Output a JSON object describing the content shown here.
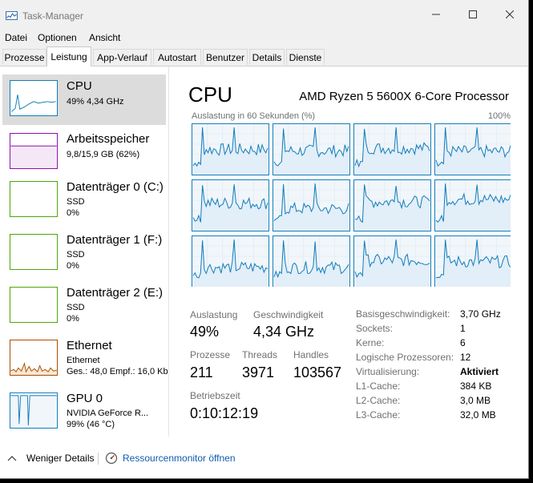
{
  "window": {
    "title": "Task-Manager"
  },
  "menu": [
    "Datei",
    "Optionen",
    "Ansicht"
  ],
  "tabs": [
    "Prozesse",
    "Leistung",
    "App-Verlauf",
    "Autostart",
    "Benutzer",
    "Details",
    "Dienste"
  ],
  "active_tab": "Leistung",
  "sidebar": {
    "items": [
      {
        "name": "CPU",
        "sub1": "49% 4,34 GHz",
        "color": "#117dbb",
        "selected": true
      },
      {
        "name": "Arbeitsspeicher",
        "sub1": "9,8/15,9 GB (62%)",
        "color": "#8b12ae"
      },
      {
        "name": "Datenträger 0 (C:)",
        "sub1": "SSD",
        "sub2": "0%",
        "color": "#4da60c"
      },
      {
        "name": "Datenträger 1 (F:)",
        "sub1": "SSD",
        "sub2": "0%",
        "color": "#4da60c"
      },
      {
        "name": "Datenträger 2 (E:)",
        "sub1": "SSD",
        "sub2": "0%",
        "color": "#4da60c"
      },
      {
        "name": "Ethernet",
        "sub1": "Ethernet",
        "sub2": "Ges.: 48,0 Empf.: 16,0 Kb",
        "color": "#a74f01"
      },
      {
        "name": "GPU 0",
        "sub1": "NVIDIA GeForce R...",
        "sub2": "99% (46 °C)",
        "color": "#117dbb"
      }
    ]
  },
  "cpu": {
    "heading": "CPU",
    "model": "AMD Ryzen 5 5600X 6-Core Processor",
    "graph_label": "Auslastung in 60 Sekunden (%)",
    "graph_max": "100%",
    "stats": {
      "auslastung_label": "Auslastung",
      "auslastung_value": "49%",
      "speed_label": "Geschwindigkeit",
      "speed_value": "4,34 GHz",
      "processes_label": "Prozesse",
      "processes_value": "211",
      "threads_label": "Threads",
      "threads_value": "3971",
      "handles_label": "Handles",
      "handles_value": "103567",
      "uptime_label": "Betriebszeit",
      "uptime_value": "0:10:12:19"
    },
    "specs": [
      {
        "label": "Basisgeschwindigkeit:",
        "value": "3,70 GHz"
      },
      {
        "label": "Sockets:",
        "value": "1"
      },
      {
        "label": "Kerne:",
        "value": "6"
      },
      {
        "label": "Logische Prozessoren:",
        "value": "12"
      },
      {
        "label": "Virtualisierung:",
        "value": "Aktiviert",
        "bold": true
      },
      {
        "label": "L1-Cache:",
        "value": "384 KB"
      },
      {
        "label": "L2-Cache:",
        "value": "3,0 MB"
      },
      {
        "label": "L3-Cache:",
        "value": "32,0 MB"
      }
    ],
    "core_graphs": 12
  },
  "footer": {
    "less_details": "Weniger Details",
    "resource_monitor": "Ressourcenmonitor öffnen"
  },
  "colors": {
    "accent": "#117dbb",
    "graph_fill": "#f1f6fa",
    "graph_border": "#117dbb"
  }
}
